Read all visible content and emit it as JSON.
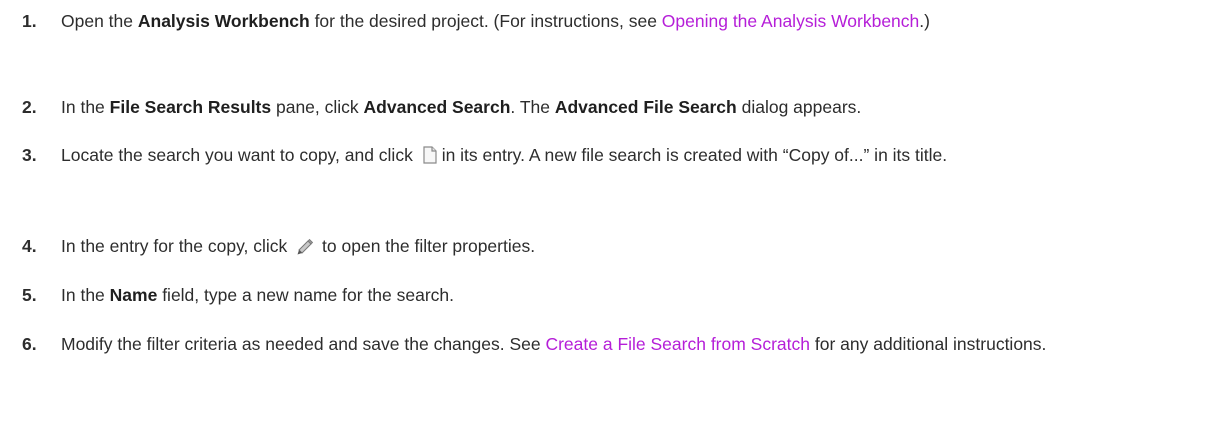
{
  "steps": [
    {
      "number": "1.",
      "t1": "Open the ",
      "b1": "Analysis Workbench",
      "t2": " for the desired project. (For instructions, see ",
      "link": "Opening the Analysis Workbench",
      "t3": ".)"
    },
    {
      "number": "2.",
      "t1": "In the ",
      "b1": "File Search Results",
      "t2": " pane, click ",
      "b2": "Advanced Search",
      "t3": ". The ",
      "b3": "Advanced File Search",
      "t4": " dialog appears."
    },
    {
      "number": "3.",
      "t1": "Locate the search you want to copy, and click ",
      "icon": "copy-icon",
      "t2": "in its entry. A new file search is created with “Copy of...” in its title."
    },
    {
      "number": "4.",
      "t1": "In the entry for the copy, click ",
      "icon": "pencil-icon",
      "t2": " to open the filter properties."
    },
    {
      "number": "5.",
      "t1": "In the ",
      "b1": "Name",
      "t2": " field, type a new name for the search."
    },
    {
      "number": "6.",
      "t1": "Modify the filter criteria as needed and save the changes. See ",
      "link": "Create a File Search from Scratch",
      "t2": " for any additional instructions."
    }
  ],
  "colors": {
    "text": "#2d2d2d",
    "link": "#b51ed8",
    "background": "#ffffff"
  }
}
